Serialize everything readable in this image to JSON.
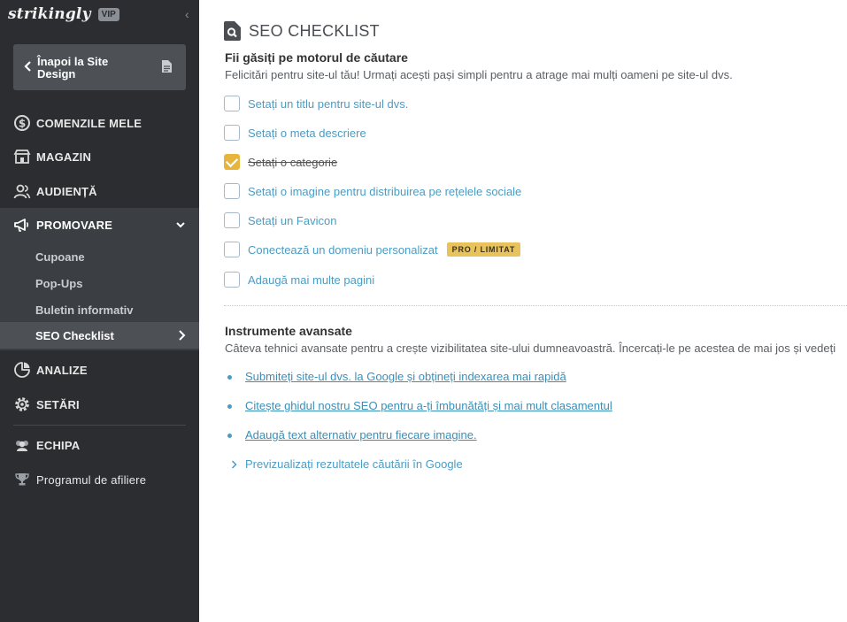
{
  "sidebar": {
    "logo": "strikingly",
    "vip": "VIP",
    "back_label": "Înapoi la Site Design",
    "nav": {
      "orders": "COMENZILE MELE",
      "store": "MAGAZIN",
      "audience": "AUDIENȚĂ",
      "promote": "PROMOVARE",
      "analytics": "ANALIZE",
      "settings": "SETĂRI",
      "team": "ECHIPA",
      "affiliate": "Programul de afiliere"
    },
    "sub": {
      "coupons": "Cupoane",
      "popups": "Pop-Ups",
      "newsletter": "Buletin informativ",
      "seo": "SEO Checklist"
    }
  },
  "main": {
    "title": "SEO CHECKLIST",
    "search": {
      "heading": "Fii găsiți pe motorul de căutare",
      "desc": "Felicitări pentru site-ul tău! Urmați acești pași simpli pentru a atrage mai mulți oameni pe site-ul dvs."
    },
    "checklist": [
      {
        "label": "Setați un titlu pentru site-ul dvs.",
        "checked": false
      },
      {
        "label": "Setați o meta descriere",
        "checked": false
      },
      {
        "label": "Setați o categorie",
        "checked": true
      },
      {
        "label": "Setați o imagine pentru distribuirea pe rețelele sociale",
        "checked": false
      },
      {
        "label": "Setați un Favicon",
        "checked": false
      },
      {
        "label": "Conectează un domeniu personalizat",
        "checked": false,
        "badge": "PRO / LIMITAT"
      },
      {
        "label": "Adaugă mai multe pagini",
        "checked": false
      }
    ],
    "advanced": {
      "heading": "Instrumente avansate",
      "desc": "Câteva tehnici avansate pentru a crește vizibilitatea site-ului dumneavoastră. Încercați-le pe acestea de mai jos și vedeți",
      "links": [
        "Submiteți site-ul dvs. la Google și obțineți indexarea mai rapidă",
        "Citește ghidul nostru SEO pentru a-ți îmbunătăți și mai mult clasamentul",
        "Adaugă text alternativ pentru fiecare imagine."
      ],
      "preview": "Previzualizați rezultatele căutării în Google"
    }
  },
  "colors": {
    "sidebar_bg": "#2b2d30",
    "accent_link": "#4a9cc4",
    "check_done": "#e8b53c"
  }
}
